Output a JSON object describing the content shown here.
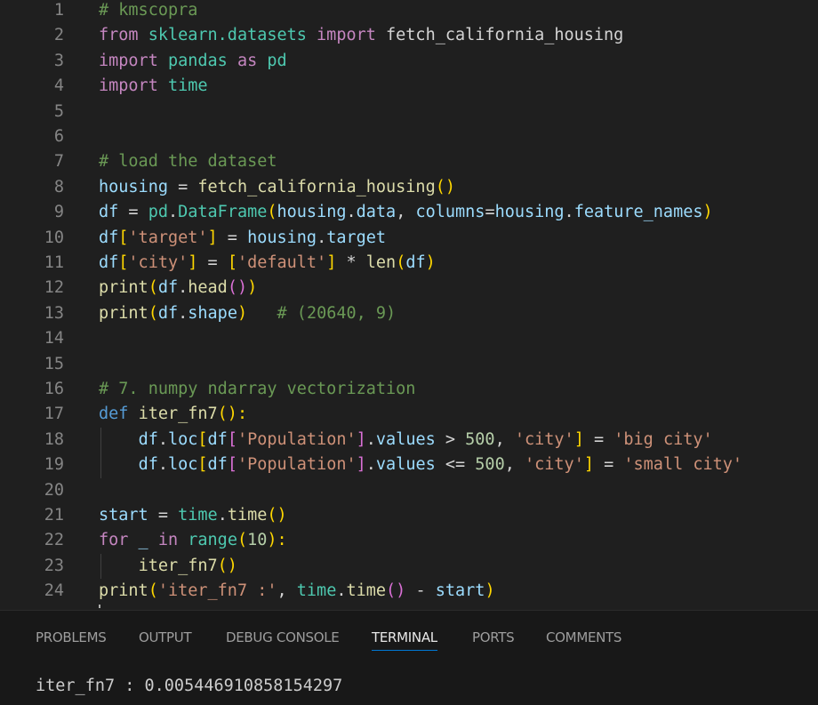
{
  "editor": {
    "lines": [
      {
        "n": "1",
        "tokens": [
          [
            "# kmscopra",
            "comment"
          ]
        ]
      },
      {
        "n": "2",
        "tokens": [
          [
            "from",
            "keyword"
          ],
          [
            " sklearn.datasets ",
            "class"
          ],
          [
            "import",
            "keyword"
          ],
          [
            " fetch_california_housing",
            "plain"
          ]
        ]
      },
      {
        "n": "3",
        "tokens": [
          [
            "import",
            "keyword"
          ],
          [
            " pandas ",
            "class"
          ],
          [
            "as",
            "keyword"
          ],
          [
            " pd",
            "class"
          ]
        ]
      },
      {
        "n": "4",
        "tokens": [
          [
            "import",
            "keyword"
          ],
          [
            " time",
            "class"
          ]
        ]
      },
      {
        "n": "5",
        "tokens": []
      },
      {
        "n": "6",
        "tokens": []
      },
      {
        "n": "7",
        "tokens": [
          [
            "# load the dataset",
            "comment"
          ]
        ]
      },
      {
        "n": "8",
        "tokens": [
          [
            "housing",
            "var"
          ],
          [
            " = ",
            "plain"
          ],
          [
            "fetch_california_housing",
            "func"
          ],
          [
            "()",
            "bracket1"
          ]
        ]
      },
      {
        "n": "9",
        "tokens": [
          [
            "df",
            "var"
          ],
          [
            " = ",
            "plain"
          ],
          [
            "pd",
            "class"
          ],
          [
            ".",
            "plain"
          ],
          [
            "DataFrame",
            "class"
          ],
          [
            "(",
            "bracket1"
          ],
          [
            "housing",
            "var"
          ],
          [
            ".",
            "plain"
          ],
          [
            "data",
            "var"
          ],
          [
            ", ",
            "plain"
          ],
          [
            "columns",
            "var"
          ],
          [
            "=",
            "plain"
          ],
          [
            "housing",
            "var"
          ],
          [
            ".",
            "plain"
          ],
          [
            "feature_names",
            "var"
          ],
          [
            ")",
            "bracket1"
          ]
        ]
      },
      {
        "n": "10",
        "tokens": [
          [
            "df",
            "var"
          ],
          [
            "[",
            "bracket1"
          ],
          [
            "'target'",
            "string"
          ],
          [
            "]",
            "bracket1"
          ],
          [
            " = ",
            "plain"
          ],
          [
            "housing",
            "var"
          ],
          [
            ".",
            "plain"
          ],
          [
            "target",
            "var"
          ]
        ]
      },
      {
        "n": "11",
        "tokens": [
          [
            "df",
            "var"
          ],
          [
            "[",
            "bracket1"
          ],
          [
            "'city'",
            "string"
          ],
          [
            "]",
            "bracket1"
          ],
          [
            " = ",
            "plain"
          ],
          [
            "[",
            "bracket1"
          ],
          [
            "'default'",
            "string"
          ],
          [
            "]",
            "bracket1"
          ],
          [
            " * ",
            "plain"
          ],
          [
            "len",
            "func"
          ],
          [
            "(",
            "bracket1"
          ],
          [
            "df",
            "var"
          ],
          [
            ")",
            "bracket1"
          ]
        ]
      },
      {
        "n": "12",
        "tokens": [
          [
            "print",
            "func"
          ],
          [
            "(",
            "bracket1"
          ],
          [
            "df",
            "var"
          ],
          [
            ".",
            "plain"
          ],
          [
            "head",
            "func"
          ],
          [
            "()",
            "bracket2"
          ],
          [
            ")",
            "bracket1"
          ]
        ]
      },
      {
        "n": "13",
        "tokens": [
          [
            "print",
            "func"
          ],
          [
            "(",
            "bracket1"
          ],
          [
            "df",
            "var"
          ],
          [
            ".",
            "plain"
          ],
          [
            "shape",
            "var"
          ],
          [
            ")",
            "bracket1"
          ],
          [
            "   ",
            "plain"
          ],
          [
            "# (20640, 9)",
            "comment"
          ]
        ]
      },
      {
        "n": "14",
        "tokens": []
      },
      {
        "n": "15",
        "tokens": []
      },
      {
        "n": "16",
        "tokens": [
          [
            "# 7. numpy ndarray vectorization",
            "comment"
          ]
        ]
      },
      {
        "n": "17",
        "tokens": [
          [
            "def",
            "def"
          ],
          [
            " ",
            "plain"
          ],
          [
            "iter_fn7",
            "func"
          ],
          [
            "():",
            "bracket1"
          ]
        ]
      },
      {
        "n": "18",
        "tokens": [
          [
            "    ",
            "plain"
          ],
          [
            "df",
            "var"
          ],
          [
            ".",
            "plain"
          ],
          [
            "loc",
            "var"
          ],
          [
            "[",
            "bracket1"
          ],
          [
            "df",
            "var"
          ],
          [
            "[",
            "bracket2"
          ],
          [
            "'Population'",
            "string"
          ],
          [
            "]",
            "bracket2"
          ],
          [
            ".",
            "plain"
          ],
          [
            "values",
            "var"
          ],
          [
            " > ",
            "plain"
          ],
          [
            "500",
            "number"
          ],
          [
            ", ",
            "plain"
          ],
          [
            "'city'",
            "string"
          ],
          [
            "]",
            "bracket1"
          ],
          [
            " = ",
            "plain"
          ],
          [
            "'big city'",
            "string"
          ]
        ]
      },
      {
        "n": "19",
        "tokens": [
          [
            "    ",
            "plain"
          ],
          [
            "df",
            "var"
          ],
          [
            ".",
            "plain"
          ],
          [
            "loc",
            "var"
          ],
          [
            "[",
            "bracket1"
          ],
          [
            "df",
            "var"
          ],
          [
            "[",
            "bracket2"
          ],
          [
            "'Population'",
            "string"
          ],
          [
            "]",
            "bracket2"
          ],
          [
            ".",
            "plain"
          ],
          [
            "values",
            "var"
          ],
          [
            " <= ",
            "plain"
          ],
          [
            "500",
            "number"
          ],
          [
            ", ",
            "plain"
          ],
          [
            "'city'",
            "string"
          ],
          [
            "]",
            "bracket1"
          ],
          [
            " = ",
            "plain"
          ],
          [
            "'small city'",
            "string"
          ]
        ]
      },
      {
        "n": "20",
        "tokens": []
      },
      {
        "n": "21",
        "tokens": [
          [
            "start",
            "var"
          ],
          [
            " = ",
            "plain"
          ],
          [
            "time",
            "class"
          ],
          [
            ".",
            "plain"
          ],
          [
            "time",
            "func"
          ],
          [
            "()",
            "bracket1"
          ]
        ]
      },
      {
        "n": "22",
        "tokens": [
          [
            "for",
            "keyword"
          ],
          [
            " _ ",
            "var"
          ],
          [
            "in",
            "keyword"
          ],
          [
            " ",
            "plain"
          ],
          [
            "range",
            "class"
          ],
          [
            "(",
            "bracket1"
          ],
          [
            "10",
            "number"
          ],
          [
            "):",
            "bracket1"
          ]
        ]
      },
      {
        "n": "23",
        "tokens": [
          [
            "    ",
            "plain"
          ],
          [
            "iter_fn7",
            "func"
          ],
          [
            "()",
            "bracket1"
          ]
        ]
      },
      {
        "n": "24",
        "tokens": [
          [
            "print",
            "func"
          ],
          [
            "(",
            "bracket1"
          ],
          [
            "'iter_fn7 :'",
            "string"
          ],
          [
            ", ",
            "plain"
          ],
          [
            "time",
            "class"
          ],
          [
            ".",
            "plain"
          ],
          [
            "time",
            "func"
          ],
          [
            "()",
            "bracket2"
          ],
          [
            " - ",
            "plain"
          ],
          [
            "start",
            "var"
          ],
          [
            ")",
            "bracket1"
          ]
        ]
      }
    ]
  },
  "panel": {
    "tabs": [
      {
        "label": "PROBLEMS"
      },
      {
        "label": "OUTPUT"
      },
      {
        "label": "DEBUG CONSOLE"
      },
      {
        "label": "TERMINAL",
        "active": true
      },
      {
        "label": "PORTS"
      },
      {
        "label": "COMMENTS"
      }
    ],
    "terminal_output": "iter_fn7 : 0.005446910858154297"
  }
}
